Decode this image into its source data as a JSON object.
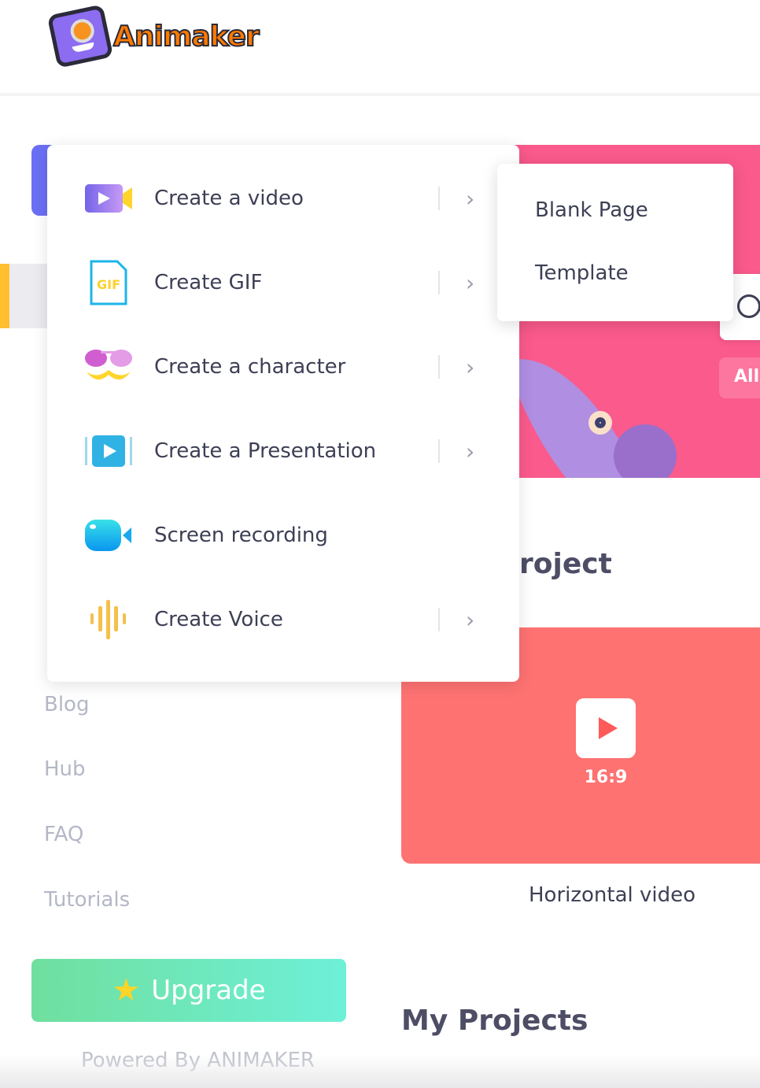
{
  "brand": {
    "name": "Animaker"
  },
  "sidebar": {
    "links": [
      "Blog",
      "Hub",
      "FAQ",
      "Tutorials"
    ],
    "upgrade_label": "Upgrade",
    "powered_by": "Powered By ANIMAKER",
    "active_color": "#ffbf2f",
    "create_color": "#6b6ff5"
  },
  "create_menu": {
    "items": [
      {
        "label": "Create a video",
        "icon": "video-camera-icon",
        "has_submenu": true
      },
      {
        "label": "Create GIF",
        "icon": "gif-file-icon",
        "has_submenu": true
      },
      {
        "label": "Create a character",
        "icon": "glasses-mustache-icon",
        "has_submenu": true
      },
      {
        "label": "Create a Presentation",
        "icon": "presentation-play-icon",
        "has_submenu": true
      },
      {
        "label": "Screen recording",
        "icon": "screen-record-camera-icon",
        "has_submenu": false
      },
      {
        "label": "Create Voice",
        "icon": "voice-waveform-icon",
        "has_submenu": true
      }
    ]
  },
  "submenu": {
    "items": [
      "Blank Page",
      "Template"
    ]
  },
  "main": {
    "filter_chip": "All",
    "section_title_partial": "roject",
    "card": {
      "ratio": "16:9",
      "label": "Horizontal video",
      "color": "#fe7272"
    },
    "my_projects_title": "My Projects",
    "banner_color": "#fa5a8c"
  }
}
